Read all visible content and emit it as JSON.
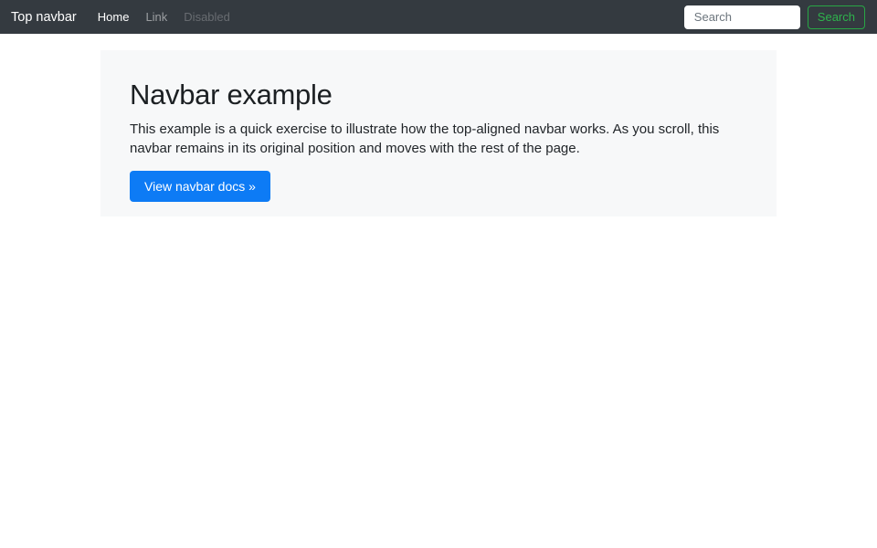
{
  "navbar": {
    "brand": "Top navbar",
    "items": [
      {
        "label": "Home",
        "state": "active"
      },
      {
        "label": "Link",
        "state": "normal"
      },
      {
        "label": "Disabled",
        "state": "disabled"
      }
    ],
    "search": {
      "placeholder": "Search",
      "value": "",
      "button_label": "Search"
    },
    "colors": {
      "background": "#343a40",
      "active_link": "#ffffff",
      "link": "rgba(255,255,255,0.5)",
      "disabled_link": "rgba(255,255,255,0.25)",
      "search_button_accent": "#28a745"
    }
  },
  "jumbotron": {
    "title": "Navbar example",
    "body": "This example is a quick exercise to illustrate how the top-aligned navbar works. As you scroll, this navbar remains in its original position and moves with the rest of the page.",
    "cta_label": "View navbar docs »",
    "colors": {
      "background": "#f7f8f9",
      "cta": "#0d7bf5"
    }
  }
}
